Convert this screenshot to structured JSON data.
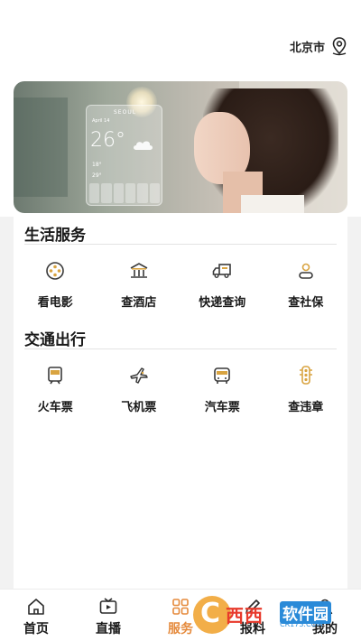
{
  "header": {
    "city": "北京市",
    "location_icon": "location-pin-icon"
  },
  "banner": {
    "weather_city": "SEOUL",
    "weather_date": "April 14",
    "weather_temp": "26°",
    "weather_low": "18°",
    "weather_high": "29°"
  },
  "life_services": {
    "title": "生活服务",
    "items": [
      {
        "label": "看电影",
        "icon": "film-reel-icon"
      },
      {
        "label": "查酒店",
        "icon": "hotel-icon"
      },
      {
        "label": "快递查询",
        "icon": "delivery-truck-icon"
      },
      {
        "label": "查社保",
        "icon": "person-icon"
      }
    ]
  },
  "transport": {
    "title": "交通出行",
    "items": [
      {
        "label": "火车票",
        "icon": "train-icon"
      },
      {
        "label": "飞机票",
        "icon": "airplane-icon"
      },
      {
        "label": "汽车票",
        "icon": "bus-icon"
      },
      {
        "label": "查违章",
        "icon": "traffic-light-icon"
      }
    ]
  },
  "tabbar": {
    "items": [
      {
        "label": "首页",
        "icon": "home-icon"
      },
      {
        "label": "直播",
        "icon": "tv-icon"
      },
      {
        "label": "服务",
        "icon": "grid-icon",
        "active": true
      },
      {
        "label": "报料",
        "icon": "edit-icon"
      },
      {
        "label": "我的",
        "icon": "user-icon"
      }
    ]
  },
  "watermark": {
    "text1": "西西",
    "text2": "软件园",
    "url": "CR173.COM"
  },
  "colors": {
    "accent": "#e58a3c",
    "icon_dark": "#3a3a3a",
    "icon_gold": "#d9a441"
  }
}
